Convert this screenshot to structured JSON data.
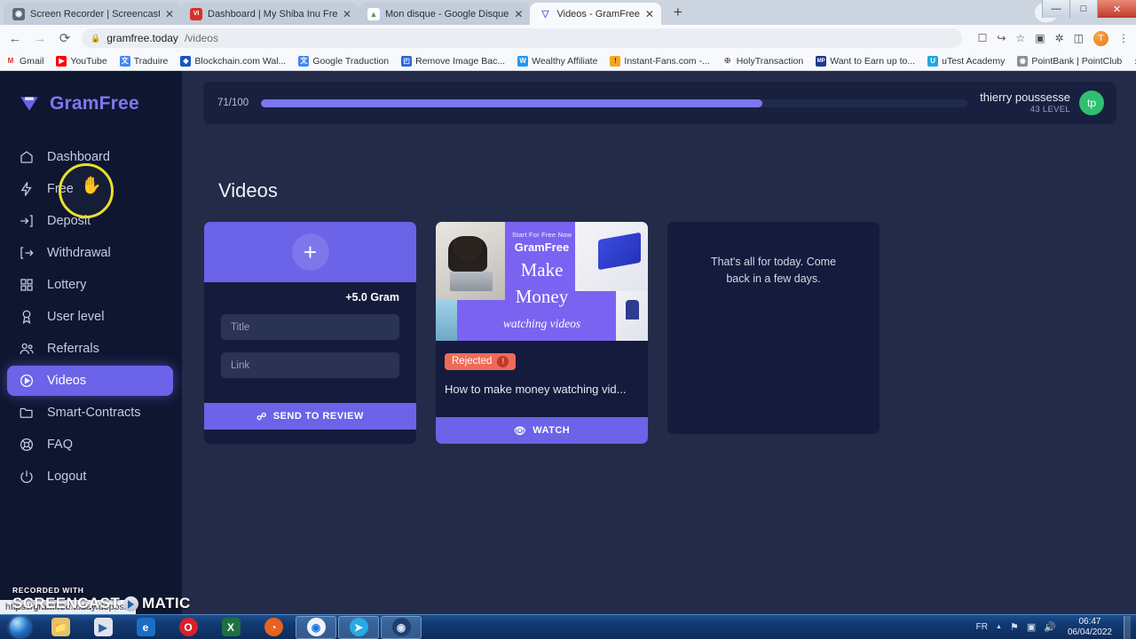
{
  "browser": {
    "tabs": [
      {
        "title": "Screen Recorder | Screencast-O",
        "favicon_name": "screencast-icon",
        "favicon_glyph": "◉",
        "favicon_bg": "#5a6a7a",
        "active": false
      },
      {
        "title": "Dashboard | My Shiba Inu Free|",
        "favicon_name": "shiba-icon",
        "favicon_glyph": "VI",
        "favicon_bg": "#d93025",
        "active": false
      },
      {
        "title": "Mon disque - Google Disque",
        "favicon_name": "google-drive-icon",
        "favicon_glyph": "▲",
        "favicon_bg": "#34a853",
        "active": false
      },
      {
        "title": "Videos - GramFree",
        "favicon_name": "gramfree-icon",
        "favicon_glyph": "▽",
        "favicon_bg": "#6b63e8",
        "active": true
      }
    ],
    "new_tab_label": "+",
    "close_glyph": "✕",
    "window_controls": {
      "minimize": "—",
      "maximize": "□",
      "close": "✕",
      "caret": "⌄"
    },
    "nav": {
      "back": "←",
      "forward": "→",
      "reload": "⟳"
    },
    "url": {
      "lock": "ὑ2",
      "domain": "gramfree.today",
      "path": "/videos"
    },
    "omni_icons": [
      {
        "name": "translate-icon",
        "glyph": "文"
      },
      {
        "name": "share-icon",
        "glyph": "↪"
      },
      {
        "name": "bookmark-star-icon",
        "glyph": "☆"
      },
      {
        "name": "extension-puzzle-icon",
        "glyph": "⚙"
      },
      {
        "name": "extensions-icon",
        "glyph": "✦"
      },
      {
        "name": "sidepanel-icon",
        "glyph": "◧"
      }
    ],
    "profile_initial": "T",
    "menu_glyph": "⋮",
    "bookmarks": [
      {
        "label": "Gmail",
        "icon_name": "gmail-icon",
        "glyph": "M",
        "bg": "#ffffff",
        "fg": "#d93025"
      },
      {
        "label": "YouTube",
        "icon_name": "youtube-icon",
        "glyph": "▶",
        "bg": "#ff0000",
        "fg": "#ffffff"
      },
      {
        "label": "Traduire",
        "icon_name": "translate-icon",
        "glyph": "文",
        "bg": "#4285f4",
        "fg": "#ffffff"
      },
      {
        "label": "Blockchain.com Wal...",
        "icon_name": "blockchain-icon",
        "glyph": "◆",
        "bg": "#1656c1",
        "fg": "#ffffff"
      },
      {
        "label": "Google Traduction",
        "icon_name": "google-translate-icon",
        "glyph": "文",
        "bg": "#4285f4",
        "fg": "#ffffff"
      },
      {
        "label": "Remove Image Bac...",
        "icon_name": "removebg-icon",
        "glyph": "◰",
        "bg": "#2a64d8",
        "fg": "#ffffff"
      },
      {
        "label": "Wealthy Affiliate",
        "icon_name": "wealthy-affiliate-icon",
        "glyph": "W",
        "bg": "#2196f3",
        "fg": "#ffffff"
      },
      {
        "label": "Instant-Fans.com -...",
        "icon_name": "instant-fans-icon",
        "glyph": "!",
        "bg": "#f5a623",
        "fg": "#4a3000"
      },
      {
        "label": "HolyTransaction",
        "icon_name": "holytransaction-icon",
        "glyph": "✠",
        "bg": "#ffffff",
        "fg": "#555566"
      },
      {
        "label": "Want to Earn up to...",
        "icon_name": "mp-icon",
        "glyph": "MP",
        "bg": "#1b3a8c",
        "fg": "#ffffff"
      },
      {
        "label": "uTest Academy",
        "icon_name": "utest-icon",
        "glyph": "U",
        "bg": "#1fa7e0",
        "fg": "#ffffff"
      },
      {
        "label": "PointBank | PointClub",
        "icon_name": "pointclub-icon",
        "glyph": "◉",
        "bg": "#8a8f99",
        "fg": "#ffffff"
      }
    ],
    "bookmarks_overflow": "»",
    "status_url": "https://gramfree.today/deposit"
  },
  "sidebar": {
    "brand": "GramFree",
    "brand_icon": "gramfree-shield-icon",
    "items": [
      {
        "label": "Dashboard",
        "icon": "home-icon",
        "active": false
      },
      {
        "label": "Free",
        "icon": "bolt-icon",
        "active": false
      },
      {
        "label": "Deposit",
        "icon": "login-arrow-icon",
        "active": false
      },
      {
        "label": "Withdrawal",
        "icon": "logout-arrow-icon",
        "active": false
      },
      {
        "label": "Lottery",
        "icon": "grid-icon",
        "active": false
      },
      {
        "label": "User level",
        "icon": "medal-icon",
        "active": false
      },
      {
        "label": "Referrals",
        "icon": "users-icon",
        "active": false
      },
      {
        "label": "Videos",
        "icon": "play-circle-icon",
        "active": true
      },
      {
        "label": "Smart-Contracts",
        "icon": "folder-icon",
        "active": false
      },
      {
        "label": "FAQ",
        "icon": "lifebuoy-icon",
        "active": false
      },
      {
        "label": "Logout",
        "icon": "power-icon",
        "active": false
      }
    ]
  },
  "topbar": {
    "progress_text": "71/100",
    "progress_percent": 71,
    "user_name": "thierry poussesse",
    "user_level": "43 LEVEL",
    "avatar_initials": "tp",
    "avatar_color": "#2fbf71"
  },
  "main": {
    "page_title": "Videos",
    "add_card": {
      "plus_label": "+",
      "reward": "+5.0 Gram",
      "title_placeholder": "Title",
      "link_placeholder": "Link",
      "submit_label": "SEND TO REVIEW",
      "submit_icon": "external-link-icon"
    },
    "video_card": {
      "thumbnail": {
        "tagline": "Start For Free Now",
        "brand": "GramFree",
        "line1": "Make",
        "line2": "Money",
        "line3": "watching videos"
      },
      "status_badge": "Rejected",
      "status_badge_icon": "info-icon",
      "status_color": "#ef6a58",
      "title": "How to make money watching vid...",
      "watch_label": "WATCH",
      "watch_icon": "eye-icon"
    },
    "empty_card": {
      "message": "That's all for today. Come back in a few days."
    }
  },
  "watermark": {
    "line1": "RECORDED WITH",
    "line2a": "SCREENCAST",
    "line2b": "MATIC"
  },
  "taskbar": {
    "start_name": "windows-start-orb",
    "items": [
      {
        "name": "explorer-icon",
        "glyph": "📁",
        "bg": "#e8c168",
        "fg": "#6b4a00"
      },
      {
        "name": "media-player-icon",
        "glyph": "▶",
        "bg": "#e0e4ea",
        "fg": "#2a5fa8"
      },
      {
        "name": "internet-explorer-icon",
        "glyph": "e",
        "bg": "#1a6fc4",
        "fg": "#ffffff"
      },
      {
        "name": "opera-icon",
        "glyph": "O",
        "bg": "#d9202a",
        "fg": "#ffffff"
      },
      {
        "name": "excel-icon",
        "glyph": "X",
        "bg": "#1d7044",
        "fg": "#ffffff"
      },
      {
        "name": "firefox-icon",
        "glyph": "◔",
        "bg": "#e8621f",
        "fg": "#ffffff"
      },
      {
        "name": "chrome-icon",
        "glyph": "◉",
        "bg": "#f1f3f6",
        "fg": "#1a73e8"
      },
      {
        "name": "telegram-icon",
        "glyph": "➤",
        "bg": "#29a9e6",
        "fg": "#ffffff"
      },
      {
        "name": "screencast-recorder-icon",
        "glyph": "◉",
        "bg": "#1f3e6e",
        "fg": "#d7e4f5"
      }
    ],
    "tray": {
      "language": "FR",
      "up_arrow": "▲",
      "icons": [
        {
          "name": "flag-icon",
          "glyph": "⚑"
        },
        {
          "name": "network-icon",
          "glyph": "▣"
        },
        {
          "name": "volume-icon",
          "glyph": "🔊"
        }
      ],
      "time": "06:47",
      "date": "06/04/2022"
    }
  }
}
